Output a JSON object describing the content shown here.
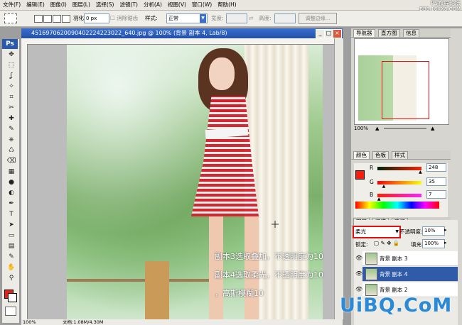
{
  "menu": [
    "文件(F)",
    "编辑(E)",
    "图像(I)",
    "图层(L)",
    "选择(S)",
    "滤镜(T)",
    "分析(A)",
    "视图(V)",
    "窗口(W)",
    "帮助(H)"
  ],
  "watermark_top": "PS教程论坛",
  "watermark_top2": "BBS.16XX8.COM",
  "options": {
    "feather_label": "羽化:",
    "feather_value": "0 px",
    "antialias_label": "消除锯齿",
    "style_label": "样式:",
    "style_value": "正常",
    "width_label": "宽度:",
    "height_label": "高度:",
    "refine_edge": "调整边缘..."
  },
  "toolbox": {
    "logo": "Ps",
    "tools": [
      "move-icon",
      "marquee-icon",
      "lasso-icon",
      "magic-wand-icon",
      "crop-icon",
      "slice-icon",
      "healing-icon",
      "brush-icon",
      "stamp-icon",
      "history-brush-icon",
      "eraser-icon",
      "gradient-icon",
      "blur-icon",
      "dodge-icon",
      "pen-icon",
      "type-icon",
      "path-select-icon",
      "shape-icon",
      "notes-icon",
      "eyedropper-icon",
      "hand-icon",
      "zoom-icon"
    ],
    "glyphs": [
      "✥",
      "⬚",
      "ʆ",
      "✧",
      "⌗",
      "✂",
      "✚",
      "✎",
      "⎈",
      "♺",
      "⌫",
      "▦",
      "●",
      "◐",
      "✒",
      "T",
      "➤",
      "▭",
      "▤",
      "✎",
      "✋",
      "⚲"
    ]
  },
  "document": {
    "title": "4516970620090402224223022_640.jpg @ 100% (背景 副本 4, Lab/8)",
    "zoom": "100%",
    "status": "文档:1.08M/4.30M"
  },
  "annotations": [
    "副本3选取叠加，不透明度为10",
    "副本4选取柔光，不透明度为10",
    "，高斯模糊10"
  ],
  "watermark_bottom": "UiBQ.CoM",
  "navigator": {
    "tabs": [
      "导航器",
      "直方图",
      "信息"
    ],
    "zoom": "100%"
  },
  "color_panel": {
    "tabs": [
      "颜色",
      "色板",
      "样式"
    ],
    "channels": [
      {
        "label": "R",
        "value": "248",
        "fraction": 0.97
      },
      {
        "label": "G",
        "value": "35",
        "fraction": 0.14
      },
      {
        "label": "B",
        "value": "7",
        "fraction": 0.03
      }
    ]
  },
  "layers_panel": {
    "tabs": [
      "图层",
      "通道",
      "路径"
    ],
    "blend_mode": "柔光",
    "opacity_label": "不透明度:",
    "opacity_value": "10%",
    "lock_label": "锁定:",
    "fill_label": "填充:",
    "fill_value": "100%",
    "layers": [
      {
        "name": "背景 副本 3",
        "selected": false
      },
      {
        "name": "背景 副本 4",
        "selected": true
      },
      {
        "name": "背景 副本 2",
        "selected": false
      }
    ]
  },
  "colors": {
    "accent_blue": "#2f5ba8",
    "foreground": "#f71c0c"
  }
}
